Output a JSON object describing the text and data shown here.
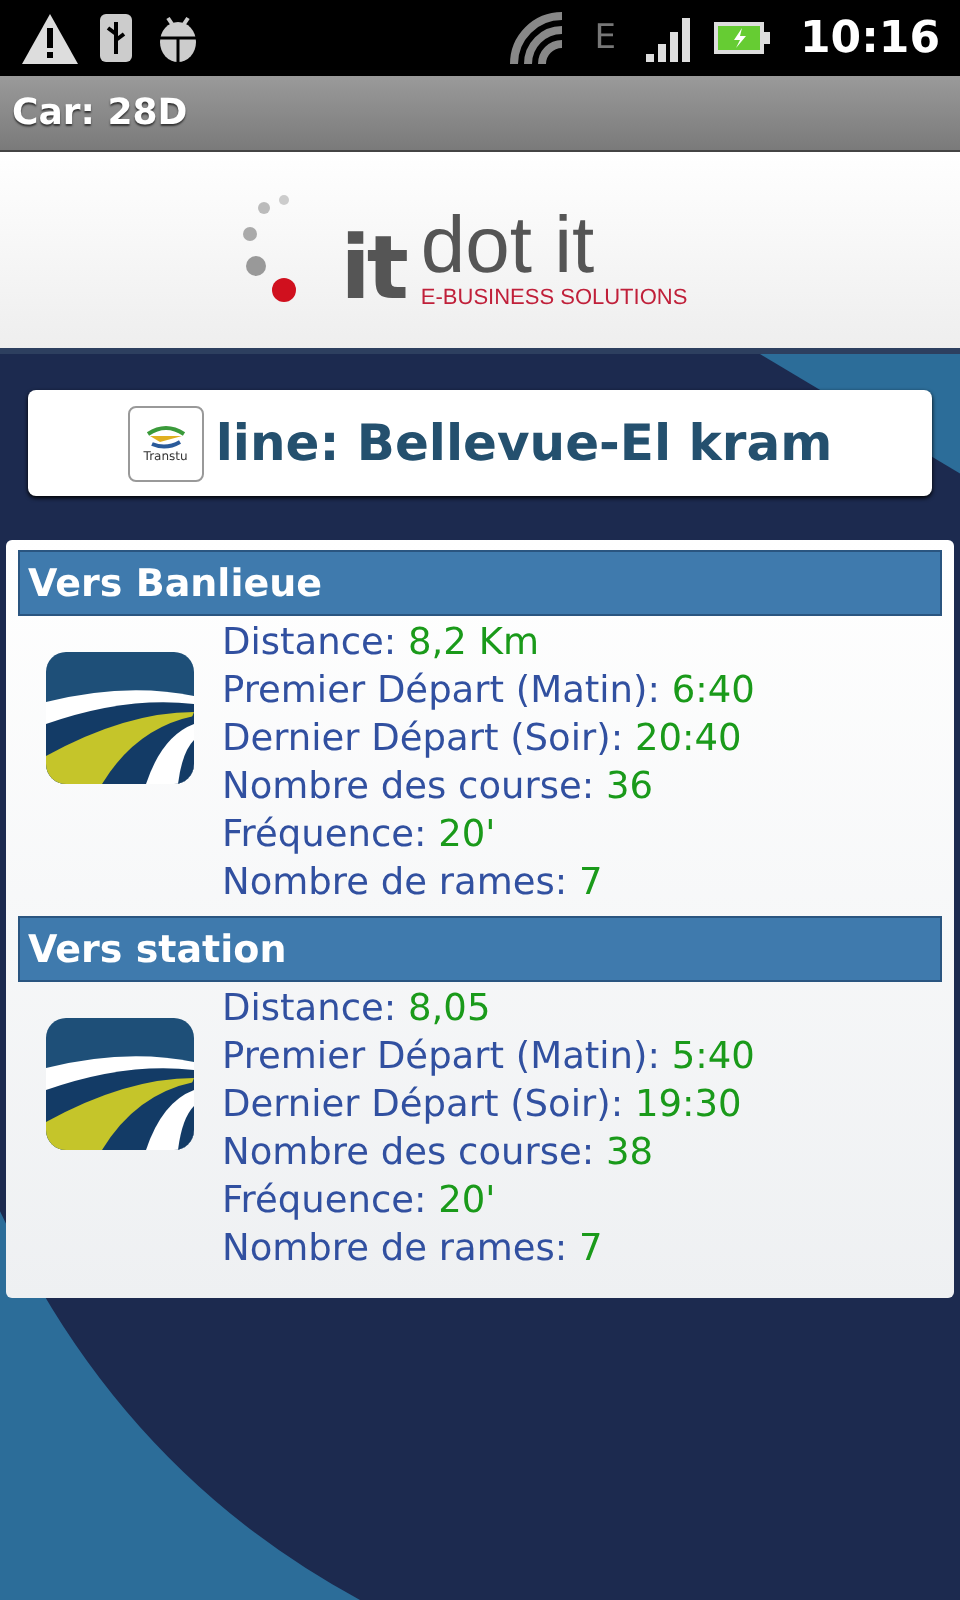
{
  "status_bar": {
    "network": "E",
    "time": "10:16"
  },
  "title_bar": {
    "title": "Car: 28D"
  },
  "logo": {
    "mark": "it",
    "name": "dot it",
    "tagline": "E-BUSINESS SOLUTIONS"
  },
  "line_header": {
    "logo_text": "Transtu",
    "title": "line: Bellevue-El kram"
  },
  "directions": [
    {
      "title": "Vers Banlieue",
      "details": [
        {
          "label": "Distance:",
          "value": "8,2 Km"
        },
        {
          "label": "Premier Départ (Matin):",
          "value": "6:40"
        },
        {
          "label": "Dernier Départ (Soir):",
          "value": "20:40"
        },
        {
          "label": "Nombre des course:",
          "value": "36"
        },
        {
          "label": "Fréquence:",
          "value": "20'"
        },
        {
          "label": "Nombre de rames:",
          "value": "7"
        }
      ]
    },
    {
      "title": "Vers station",
      "details": [
        {
          "label": "Distance:",
          "value": "8,05"
        },
        {
          "label": "Premier Départ (Matin):",
          "value": "5:40"
        },
        {
          "label": "Dernier Départ (Soir):",
          "value": "19:30"
        },
        {
          "label": "Nombre des course:",
          "value": "38"
        },
        {
          "label": "Fréquence:",
          "value": "20'"
        },
        {
          "label": "Nombre de rames:",
          "value": "7"
        }
      ]
    }
  ]
}
